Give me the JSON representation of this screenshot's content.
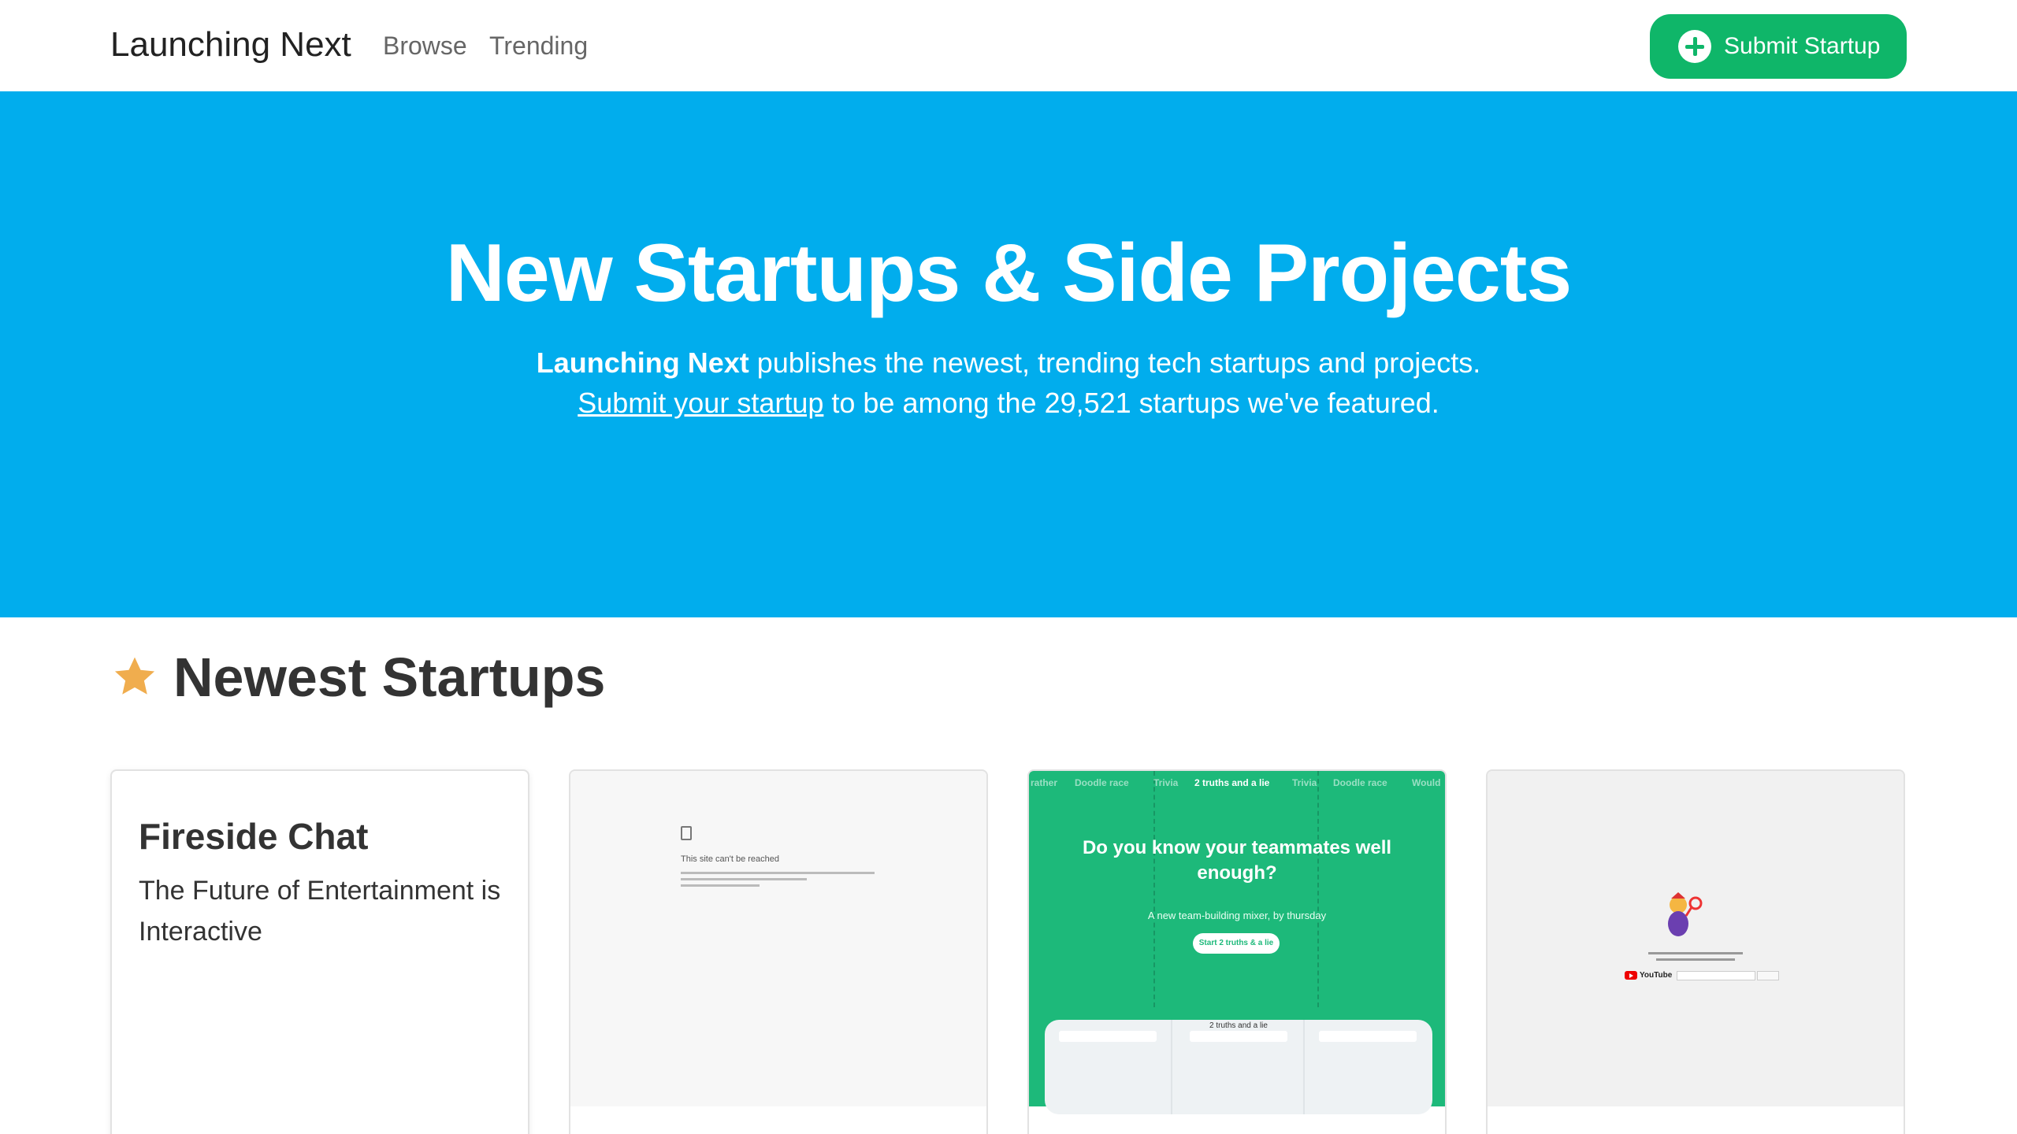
{
  "navbar": {
    "brand": "Launching Next",
    "links": [
      "Browse",
      "Trending"
    ],
    "submit_label": "Submit Startup"
  },
  "hero": {
    "title": "New Startups & Side Projects",
    "line1_bold": "Launching Next",
    "line1_rest": " publishes the newest, trending tech startups and projects.",
    "line2_link": "Submit your startup",
    "line2_rest": " to be among the 29,521 startups we've featured."
  },
  "section": {
    "title": "Newest Startups",
    "icon": "star-icon"
  },
  "cards": [
    {
      "title": "Fireside Chat",
      "description": "The Future of Entertainment is Interactive"
    },
    {
      "screenshot_text": "This site can't be reached"
    },
    {
      "screenshot_tabs": [
        "rather",
        "Doodle race",
        "Trivia",
        "2 truths and a lie",
        "Trivia",
        "Doodle race",
        "Would"
      ],
      "screenshot_heading": "Do you know your teammates well enough?",
      "screenshot_sub": "A new team-building mixer, by thursday",
      "screenshot_button": "Start 2 truths & a lie",
      "screenshot_panel_title": "2 truths and a lie"
    },
    {
      "screenshot_logo": "YouTube"
    }
  ],
  "colors": {
    "hero_bg": "#01aded",
    "submit_bg": "#0fb669",
    "star": "#f0ad4e",
    "green_shot": "#1db97a"
  }
}
